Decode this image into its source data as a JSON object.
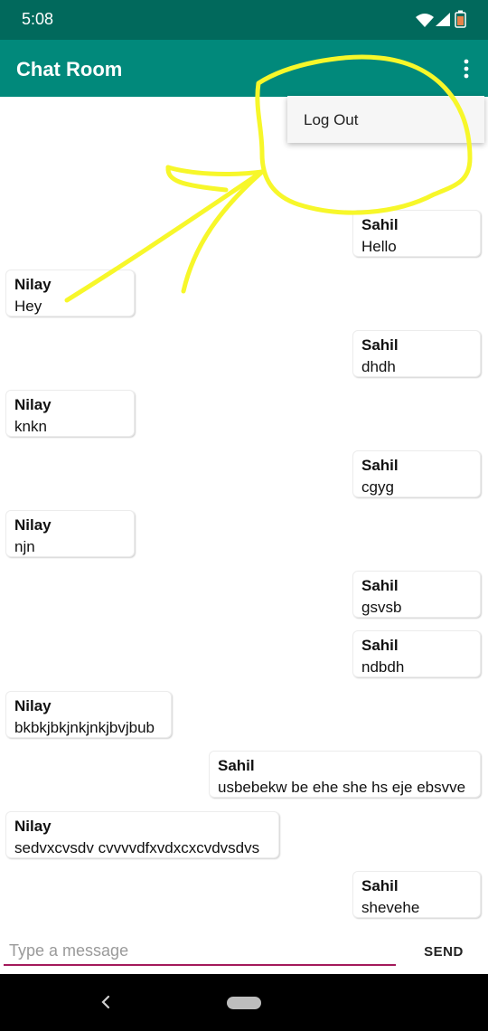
{
  "status_bar": {
    "time": "5:08"
  },
  "app_bar": {
    "title": "Chat Room"
  },
  "menu": {
    "items": [
      {
        "label": "Log Out"
      }
    ]
  },
  "messages": [
    {
      "sender": "Sahil",
      "text": "Hello",
      "side": "right"
    },
    {
      "sender": "Nilay",
      "text": "Hey",
      "side": "left"
    },
    {
      "sender": "Sahil",
      "text": "dhdh",
      "side": "right"
    },
    {
      "sender": "Nilay",
      "text": "knkn",
      "side": "left"
    },
    {
      "sender": "Sahil",
      "text": "cgyg",
      "side": "right"
    },
    {
      "sender": "Nilay",
      "text": "njn",
      "side": "left"
    },
    {
      "sender": "Sahil",
      "text": "gsvsb",
      "side": "right"
    },
    {
      "sender": "Sahil",
      "text": "ndbdh",
      "side": "right"
    },
    {
      "sender": "Nilay",
      "text": "bkbkjbkjnkjnkjbvjbub",
      "side": "left"
    },
    {
      "sender": "Sahil",
      "text": "usbebekw be ehe she hs eje ebsvve",
      "side": "right"
    },
    {
      "sender": "Nilay",
      "text": "sedvxcvsdv cvvvvdfxvdxcxcvdvsdvs",
      "side": "left"
    },
    {
      "sender": "Sahil",
      "text": "shevehe",
      "side": "right"
    }
  ],
  "composer": {
    "placeholder": "Type a message",
    "send_label": "SEND"
  },
  "colors": {
    "status_bar": "#01695c",
    "app_bar": "#01897b",
    "input_underline": "#a3195b",
    "annotation": "#f7f72a"
  }
}
